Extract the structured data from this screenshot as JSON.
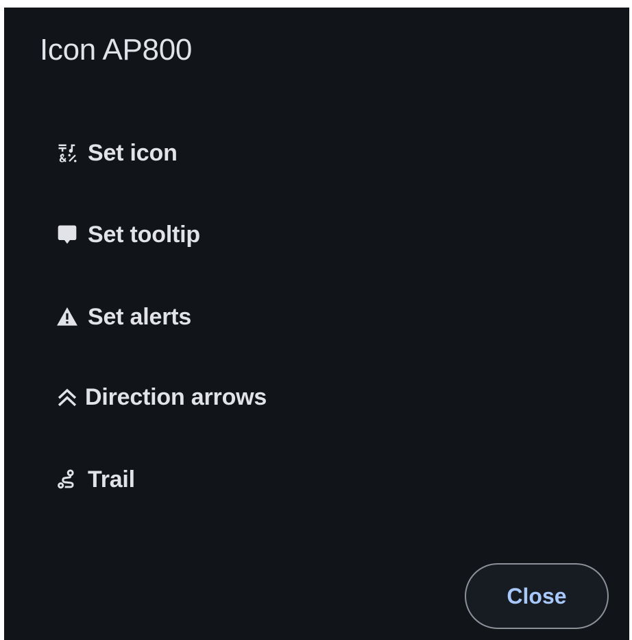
{
  "dialog": {
    "title": "Icon AP800",
    "menu_items": [
      {
        "label": "Set icon",
        "icon": "emoji-symbols-icon"
      },
      {
        "label": "Set tooltip",
        "icon": "comment-icon"
      },
      {
        "label": "Set alerts",
        "icon": "warning-icon"
      },
      {
        "label": "Direction arrows",
        "icon": "double-chevron-up-icon"
      },
      {
        "label": "Trail",
        "icon": "route-icon"
      }
    ],
    "close_label": "Close"
  },
  "colors": {
    "background": "#111418",
    "text": "#e2e2e9",
    "accent": "#a8c7fa",
    "outline": "#8e9099"
  }
}
